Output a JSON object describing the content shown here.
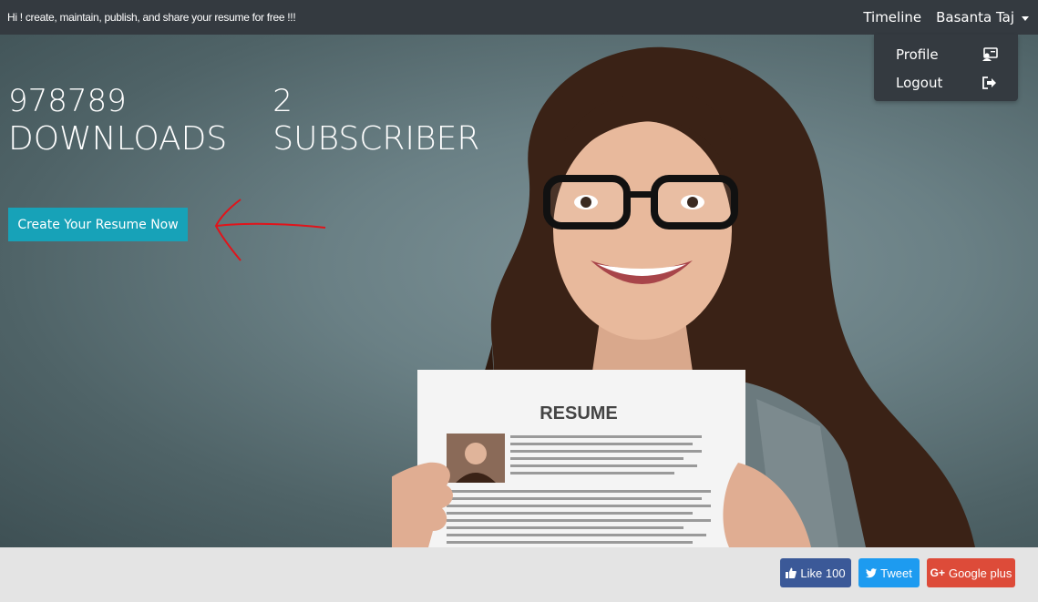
{
  "navbar": {
    "tagline": "Hi ! create, maintain, publish, and share your resume for free !!!",
    "timeline": "Timeline",
    "user_name": "Basanta Taj"
  },
  "dropdown": {
    "items": [
      {
        "label": "Profile",
        "icon": "profile-card-icon"
      },
      {
        "label": "Logout",
        "icon": "logout-icon"
      }
    ]
  },
  "hero": {
    "stats": [
      {
        "value": "978789",
        "label": "DOWNLOADS"
      },
      {
        "value": "2",
        "label": "SUBSCRIBER"
      }
    ],
    "cta_label": "Create Your Resume Now",
    "resume_heading": "RESUME"
  },
  "footer": {
    "facebook_label": "Like 100",
    "twitter_label": "Tweet",
    "google_label": "Google plus"
  },
  "colors": {
    "navbar_bg": "#343a40",
    "cta": "#17a2b8",
    "facebook": "#3b5998",
    "twitter": "#1d9bf0",
    "google": "#dd4b39",
    "annotation_arrow": "#e0141b"
  }
}
